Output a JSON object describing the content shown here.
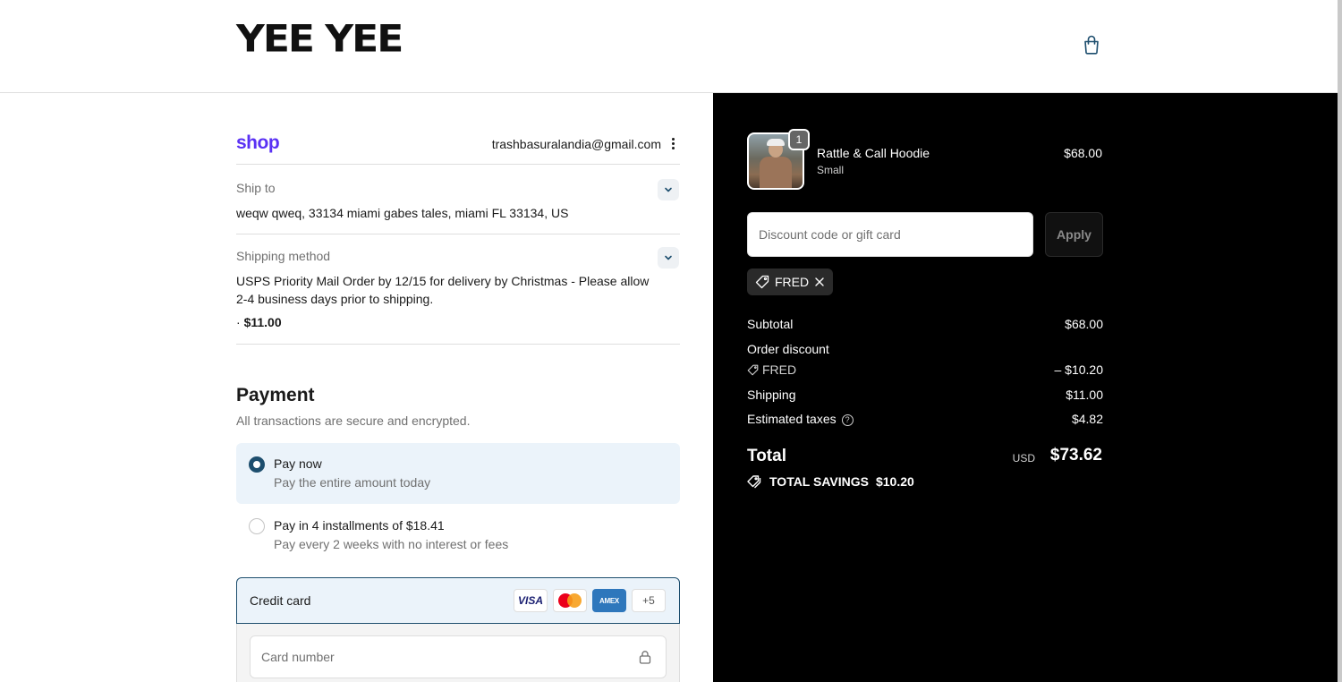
{
  "header": {
    "logo": "YEE YEE",
    "cart_icon": "shopping-bag-icon"
  },
  "account": {
    "shop_logo": "shop",
    "email": "trashbasuralandia@gmail.com",
    "menu_icon": "kebab-menu-icon"
  },
  "review": {
    "ship_to": {
      "label": "Ship to",
      "value": "weqw qweq, 33134 miami gabes tales, miami FL 33134, US"
    },
    "shipping_method": {
      "label": "Shipping method",
      "line1": "USPS Priority Mail Order by 12/15 for delivery by Christmas - Please allow",
      "line2": "2-4 business days prior to shipping.",
      "price_prefix": "·",
      "price": "$11.00"
    }
  },
  "payment": {
    "title": "Payment",
    "subtitle": "All transactions are secure and encrypted.",
    "options": [
      {
        "title": "Pay now",
        "subtitle": "Pay the entire amount today",
        "selected": true
      },
      {
        "title": "Pay in 4 installments of $18.41",
        "subtitle": "Pay every 2 weeks with no interest or fees",
        "selected": false
      }
    ],
    "credit_card": {
      "label": "Credit card",
      "brands": [
        "VISA",
        "mastercard",
        "AMEX",
        "+5"
      ],
      "card_number_placeholder": "Card number"
    }
  },
  "summary": {
    "product": {
      "quantity": "1",
      "name": "Rattle & Call Hoodie",
      "variant": "Small",
      "price": "$68.00"
    },
    "discount_placeholder": "Discount code or gift card",
    "apply_label": "Apply",
    "applied_code": "FRED",
    "subtotal_label": "Subtotal",
    "subtotal": "$68.00",
    "order_discount_label": "Order discount",
    "discount_code": "FRED",
    "discount_amount": "– $10.20",
    "shipping_label": "Shipping",
    "shipping": "$11.00",
    "taxes_label": "Estimated taxes",
    "taxes": "$4.82",
    "total_label": "Total",
    "currency": "USD",
    "total": "$73.62",
    "savings_label": "TOTAL SAVINGS",
    "savings": "$10.20"
  },
  "colors": {
    "brand_shop": "#5a31f4",
    "accent": "#1d4e6e",
    "summary_bg": "#000000"
  }
}
